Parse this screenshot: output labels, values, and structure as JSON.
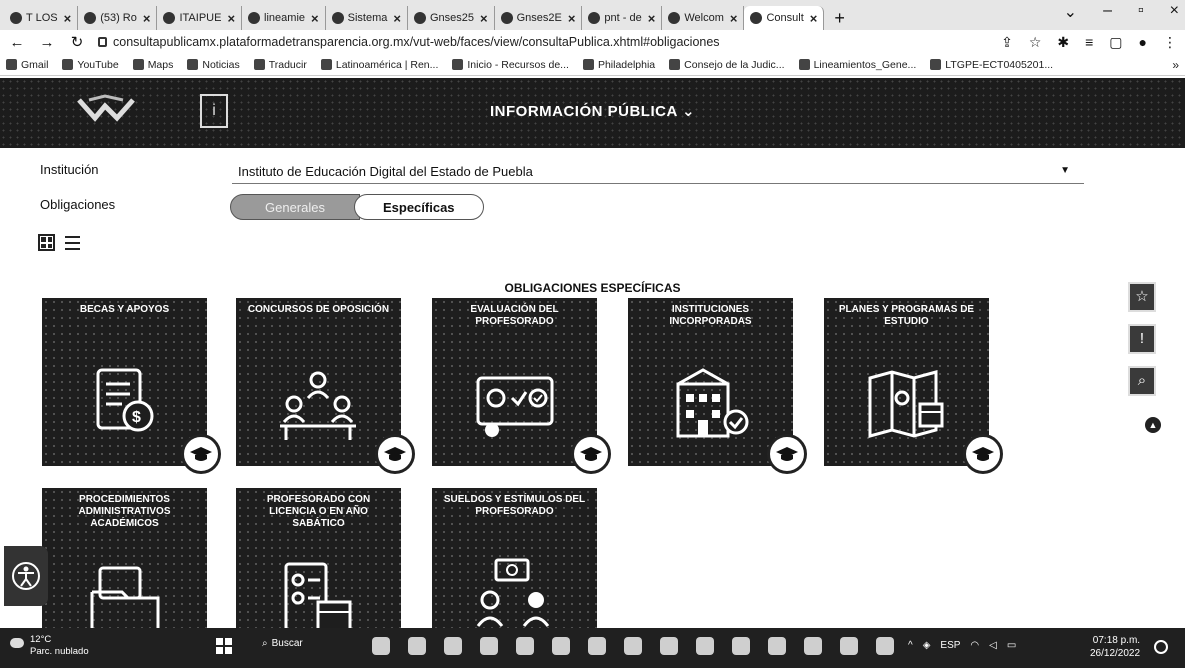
{
  "browser": {
    "tabs": [
      {
        "label": "T LOS"
      },
      {
        "label": "(53) Ro"
      },
      {
        "label": "ITAIPUE"
      },
      {
        "label": "lineamie"
      },
      {
        "label": "Sistema"
      },
      {
        "label": "Gnses25"
      },
      {
        "label": "Gnses2E"
      },
      {
        "label": "pnt - de"
      },
      {
        "label": "Welcom"
      },
      {
        "label": "Consult"
      }
    ],
    "new_tab": "+",
    "url": "consultapublicamx.plataformadetransparencia.org.mx/vut-web/faces/view/consultaPublica.xhtml#obligaciones",
    "bookmarks": [
      "Gmail",
      "YouTube",
      "Maps",
      "Noticias",
      "Traducir",
      "Latinoamérica | Ren...",
      "Inicio - Recursos de...",
      "Philadelphia",
      "Consejo de la Judic...",
      "Lineamientos_Gene...",
      "LTGPE-ECT0405201..."
    ],
    "bookmarks_more": "»"
  },
  "header": {
    "title": "INFORMACIÓN PÚBLICA"
  },
  "filters": {
    "institution_label": "Institución",
    "institution_value": "Instituto de Educación Digital del Estado de Puebla",
    "obligations_label": "Obligaciones",
    "btn_generales": "Generales",
    "btn_especificas": "Específicas"
  },
  "section_title": "OBLIGACIONES ESPECÍFICAS",
  "cards": [
    {
      "title": "BECAS Y APOYOS"
    },
    {
      "title": "CONCURSOS DE OPOSICIÓN"
    },
    {
      "title": "EVALUACIÓN DEL PROFESORADO"
    },
    {
      "title": "INSTITUCIONES INCORPORADAS"
    },
    {
      "title": "PLANES Y PROGRAMAS DE ESTUDIO"
    },
    {
      "title": "PROCEDIMIENTOS ADMINISTRATIVOS ACADÉMICOS"
    },
    {
      "title": "PROFESORADO CON LICENCIA O EN AÑO SABÁTICO"
    },
    {
      "title": "SUELDOS Y ESTÍMULOS DEL PROFESORADO"
    }
  ],
  "taskbar": {
    "weather_temp": "12°C",
    "weather_desc": "Parc. nublado",
    "search_label": "Buscar",
    "lang": "ESP",
    "time": "07:18 p.m.",
    "date": "26/12/2022"
  }
}
